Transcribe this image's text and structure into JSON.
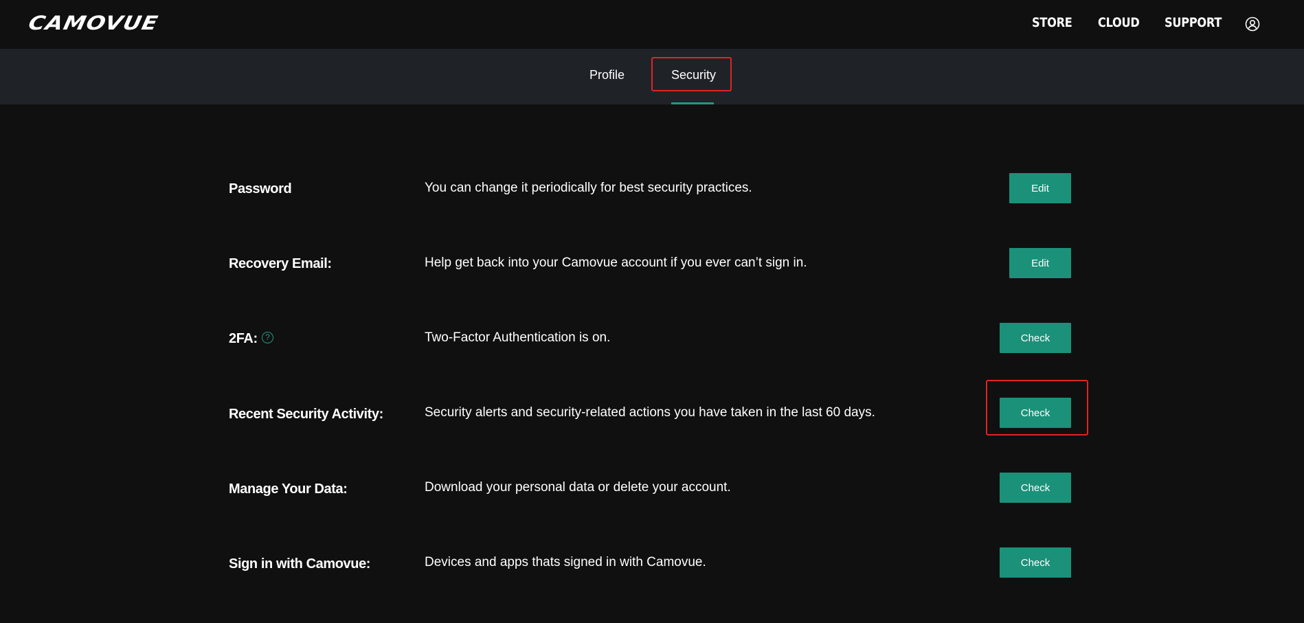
{
  "header": {
    "logo": "CAMOVUE",
    "nav": [
      "STORE",
      "CLOUD",
      "SUPPORT"
    ],
    "user_icon": "user-circle-icon"
  },
  "tabs": [
    {
      "label": "Profile",
      "active": false
    },
    {
      "label": "Security",
      "active": true
    }
  ],
  "rows": [
    {
      "label": "Password",
      "description": "You can change it periodically for best security practices.",
      "button": "Edit"
    },
    {
      "label": "Recovery Email:",
      "description": "Help get back into your Camovue account if you ever can’t sign in.",
      "button": "Edit"
    },
    {
      "label": "2FA:",
      "help_icon": "question-circle-icon",
      "help_glyph": "?",
      "description": "Two-Factor Authentication is on.",
      "button": "Check"
    },
    {
      "label": "Recent Security Activity:",
      "description": "Security alerts and security-related actions you have taken in the last 60 days.",
      "button": "Check"
    },
    {
      "label": "Manage Your Data:",
      "description": "Download your personal data or delete your account.",
      "button": "Check"
    },
    {
      "label": "Sign in with Camovue:",
      "description": "Devices and apps thats signed in with Camovue.",
      "button": "Check"
    }
  ],
  "colors": {
    "accent": "#1b917a",
    "background": "#101010",
    "subnav_background": "#1f2328",
    "highlight": "#e02424"
  }
}
